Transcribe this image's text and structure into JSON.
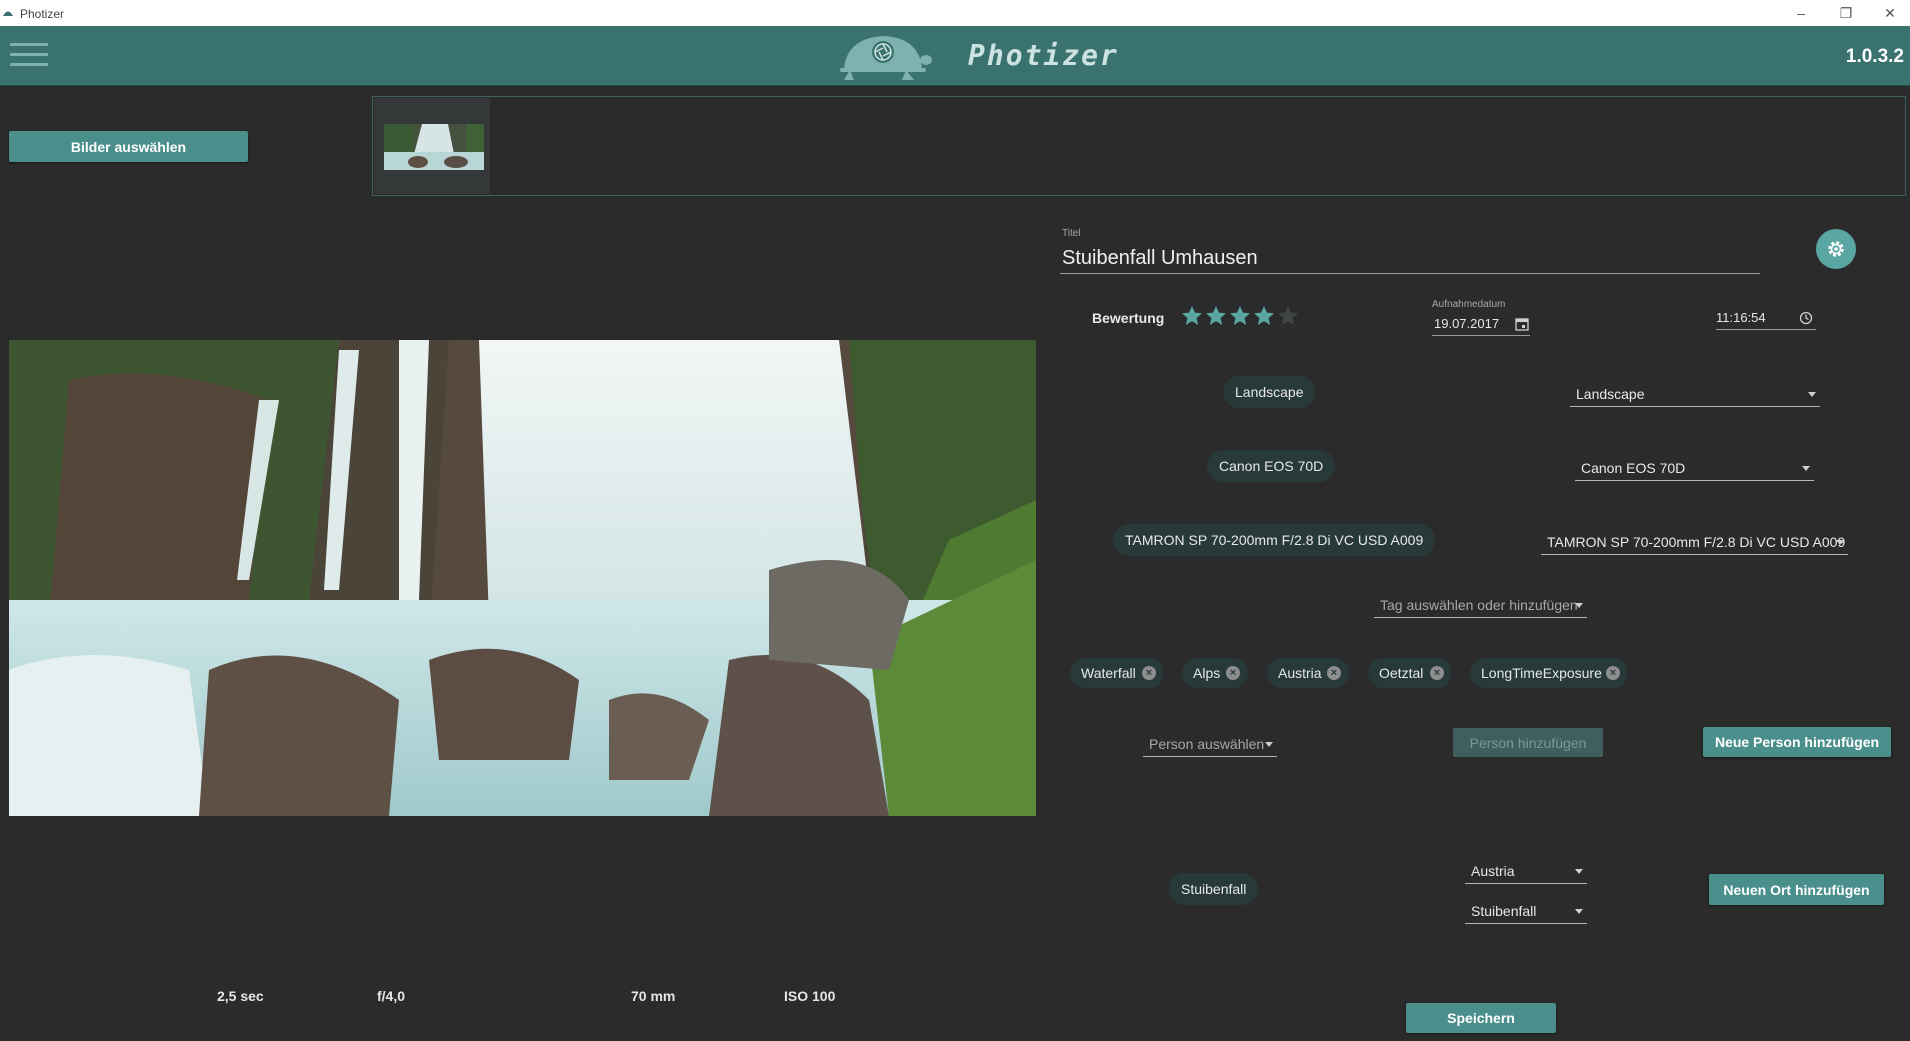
{
  "window": {
    "title": "Photizer",
    "minimize": "–",
    "restore": "❐",
    "close": "✕"
  },
  "header": {
    "logo_text": "Photizer",
    "version": "1.0.3.2",
    "menu_icon": "hamburger-menu-icon",
    "logo_icon": "turtle-aperture-logo-icon"
  },
  "left": {
    "select_images_label": "Bilder auswählen",
    "exif": {
      "exposure": "2,5 sec",
      "aperture": "f/4,0",
      "focal_length": "70 mm",
      "iso": "ISO 100"
    }
  },
  "form": {
    "title_label": "Titel",
    "title_value": "Stuibenfall Umhausen",
    "settings_icon": "gear-icon",
    "rating_label": "Bewertung",
    "rating": {
      "value": 4,
      "max": 5
    },
    "date_label": "Aufnahmedatum",
    "date_value": "19.07.2017",
    "time_value": "11:16:54",
    "category": {
      "chip": "Landscape",
      "select": "Landscape"
    },
    "camera": {
      "chip": "Canon EOS 70D",
      "select": "Canon EOS 70D"
    },
    "lens": {
      "chip": "TAMRON SP 70-200mm F/2.8 Di VC USD A009",
      "select": "TAMRON SP 70-200mm F/2.8 Di VC USD A009"
    },
    "tag_select_placeholder": "Tag auswählen oder hinzufügen",
    "tags": [
      "Waterfall",
      "Alps",
      "Austria",
      "Oetztal",
      "LongTimeExposure"
    ],
    "person_select_placeholder": "Person auswählen",
    "add_person_label": "Person hinzufügen",
    "new_person_label": "Neue Person hinzufügen",
    "place": {
      "chip": "Stuibenfall",
      "country": "Austria",
      "location": "Stuibenfall"
    },
    "new_place_label": "Neuen Ort hinzufügen",
    "save_label": "Speichern"
  },
  "colors": {
    "header": "#3a7270",
    "accent": "#4a8f8c",
    "background": "#2b2b2b",
    "chip": "#28393a",
    "star": "#5aa6a2"
  }
}
